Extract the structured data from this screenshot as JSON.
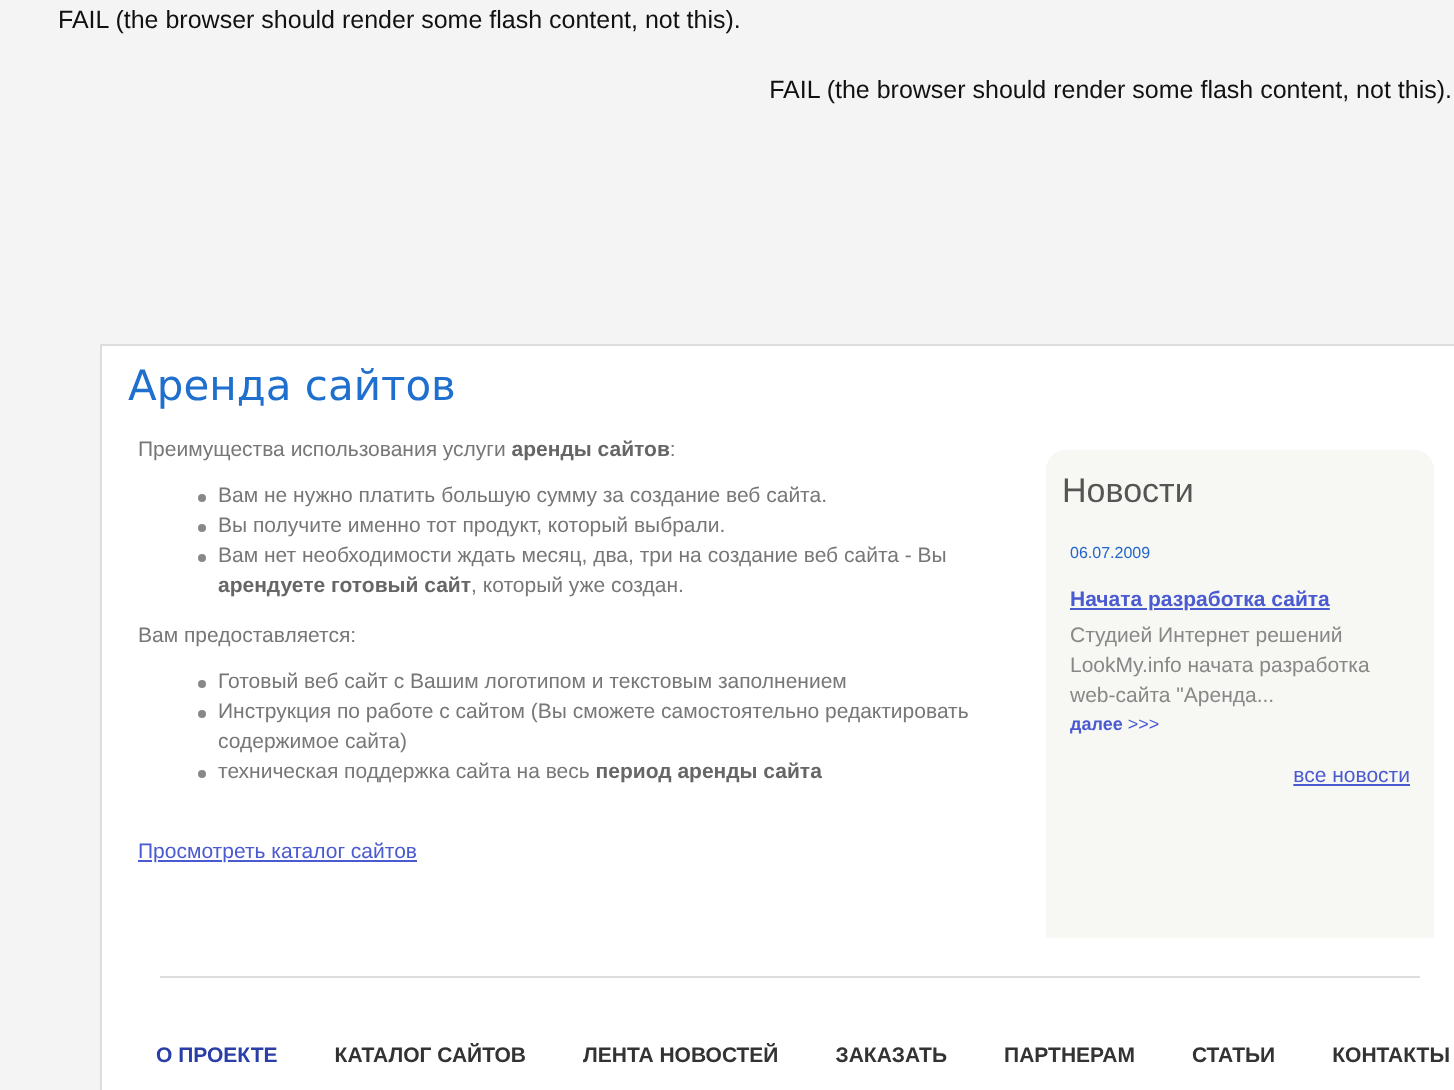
{
  "flash_notices": [
    "FAIL (the browser should render some flash content, not this).",
    "FAIL (the browser should render some flash content, not this)."
  ],
  "title": "Аренда сайтов",
  "intro": "Преимущества использования услуги **аренды сайтов**:",
  "benefits": [
    "Вам не нужно платить большую сумму за создание веб сайта.",
    "Вы получите именно тот продукт, который выбрали.",
    "Вам нет необходимости ждать месяц, два, три на создание веб сайта - Вы **арендуете готовый сайт**, который уже создан."
  ],
  "provided_intro": "Вам предоставляется:",
  "provided": [
    "Готовый веб сайт с Вашим логотипом и текстовым заполнением",
    "Инструкция по работе с сайтом (Вы сможете самостоятельно редактировать содержимое сайта)",
    "техническая поддержка сайта на весь **период аренды сайта**"
  ],
  "catalog_link": "Просмотреть каталог сайтов",
  "news": {
    "title": "Новости",
    "items": [
      {
        "date": "06.07.2009",
        "headline": "Начата разработка сайта",
        "excerpt": "Студией Интернет решений LookMy.info начата разработка web-сайта \"Аренда...",
        "more": "далее",
        "more_arrows": ">>>"
      }
    ],
    "all_link": "все новости"
  },
  "nav": [
    {
      "label": "О ПРОЕКТЕ",
      "selected": true
    },
    {
      "label": "КАТАЛОГ САЙТОВ",
      "selected": false
    },
    {
      "label": "ЛЕНТА НОВОСТЕЙ",
      "selected": false
    },
    {
      "label": "ЗАКАЗАТЬ",
      "selected": false
    },
    {
      "label": "ПАРТНЕРАМ",
      "selected": false
    },
    {
      "label": "СТАТЬИ",
      "selected": false
    },
    {
      "label": "КОНТАКТЫ",
      "selected": false
    }
  ]
}
